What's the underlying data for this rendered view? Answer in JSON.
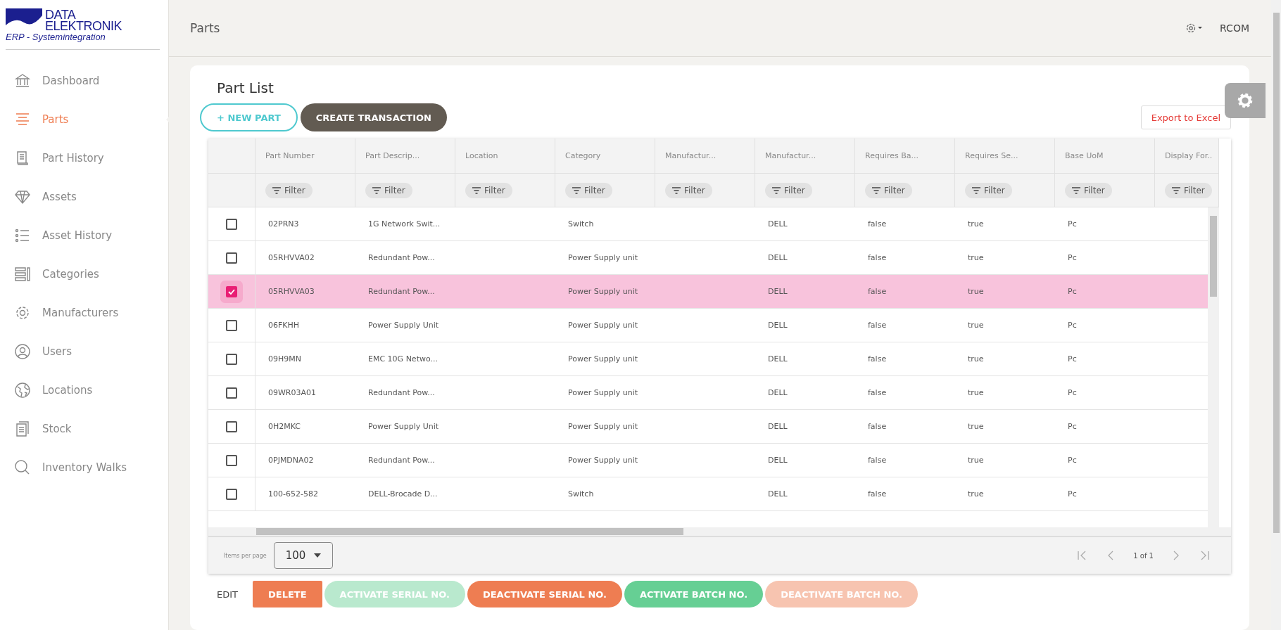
{
  "logo": {
    "line_1": "DATA",
    "line_2": "ELEKTRONIK",
    "line_3": "ERP - Systemintegration"
  },
  "sidebar": {
    "items": [
      {
        "label": "Dashboard",
        "selected": false
      },
      {
        "label": "Parts",
        "selected": true
      },
      {
        "label": "Part History",
        "selected": false
      },
      {
        "label": "Assets",
        "selected": false
      },
      {
        "label": "Asset History",
        "selected": false
      },
      {
        "label": "Categories",
        "selected": false
      },
      {
        "label": "Manufacturers",
        "selected": false
      },
      {
        "label": "Users",
        "selected": false
      },
      {
        "label": "Locations",
        "selected": false
      },
      {
        "label": "Stock",
        "selected": false
      },
      {
        "label": "Inventory Walks",
        "selected": false
      }
    ]
  },
  "header": {
    "title": "Parts",
    "user": "RCOM"
  },
  "card": {
    "title": "Part List",
    "new_button": "NEW PART",
    "new_button_icon": "+",
    "transaction_button": "CREATE TRANSACTION",
    "export_button": "Export to Excel"
  },
  "table": {
    "columns": [
      "Part Number",
      "Part Descrip...",
      "Location",
      "Category",
      "Manufactur...",
      "Manufactur...",
      "Requires Ba...",
      "Requires Se...",
      "Base UoM",
      "Display For.."
    ],
    "filters": [
      "Filter",
      "Filter",
      "Filter",
      "Filter",
      "Filter",
      "Filter",
      "Filter",
      "Filter",
      "Filter",
      "Filter"
    ],
    "rows": [
      {
        "checked": false,
        "cells": [
          "02PRN3",
          "1G Network Swit...",
          null,
          "Switch",
          null,
          "DELL",
          "false",
          "true",
          "Pc",
          null
        ]
      },
      {
        "checked": false,
        "cells": [
          "05RHVVA02",
          "Redundant Pow...",
          null,
          "Power Supply unit",
          null,
          "DELL",
          "false",
          "true",
          "Pc",
          null
        ]
      },
      {
        "checked": true,
        "cells": [
          "05RHVVA03",
          "Redundant Pow...",
          null,
          "Power Supply unit",
          null,
          "DELL",
          "false",
          "true",
          "Pc",
          null
        ]
      },
      {
        "checked": false,
        "cells": [
          "06FKHH",
          "Power Supply Unit",
          null,
          "Power Supply unit",
          null,
          "DELL",
          "false",
          "true",
          "Pc",
          null
        ]
      },
      {
        "checked": false,
        "cells": [
          "09H9MN",
          "EMC 10G Netwo...",
          null,
          "Power Supply unit",
          null,
          "DELL",
          "false",
          "true",
          "Pc",
          null
        ]
      },
      {
        "checked": false,
        "cells": [
          "09WR03A01",
          "Redundant Pow...",
          null,
          "Power Supply unit",
          null,
          "DELL",
          "false",
          "true",
          "Pc",
          null
        ]
      },
      {
        "checked": false,
        "cells": [
          "0H2MKC",
          "Power Supply Unit",
          null,
          "Power Supply unit",
          null,
          "DELL",
          "false",
          "true",
          "Pc",
          null
        ]
      },
      {
        "checked": false,
        "cells": [
          "0PJMDNA02",
          "Redundant Pow...",
          null,
          "Power Supply unit",
          null,
          "DELL",
          "false",
          "true",
          "Pc",
          null
        ]
      },
      {
        "checked": false,
        "cells": [
          "100-652-582",
          "DELL-Brocade D...",
          null,
          "Switch",
          null,
          "DELL",
          "false",
          "true",
          "Pc",
          null
        ]
      }
    ],
    "pager": {
      "items_per_page_label": "Items per page",
      "items_per_page": "100",
      "page_info": "1 of 1"
    }
  },
  "actions": [
    {
      "label": "EDIT",
      "kind": "text",
      "disabled": false
    },
    {
      "label": "DELETE",
      "kind": "danger-square",
      "disabled": false
    },
    {
      "label": "ACTIVATE SERIAL NO.",
      "kind": "success",
      "disabled": true
    },
    {
      "label": "DEACTIVATE SERIAL NO.",
      "kind": "danger",
      "disabled": false
    },
    {
      "label": "ACTIVATE BATCH NO.",
      "kind": "success",
      "disabled": false
    },
    {
      "label": "DEACTIVATE BATCH NO.",
      "kind": "danger",
      "disabled": true
    }
  ]
}
